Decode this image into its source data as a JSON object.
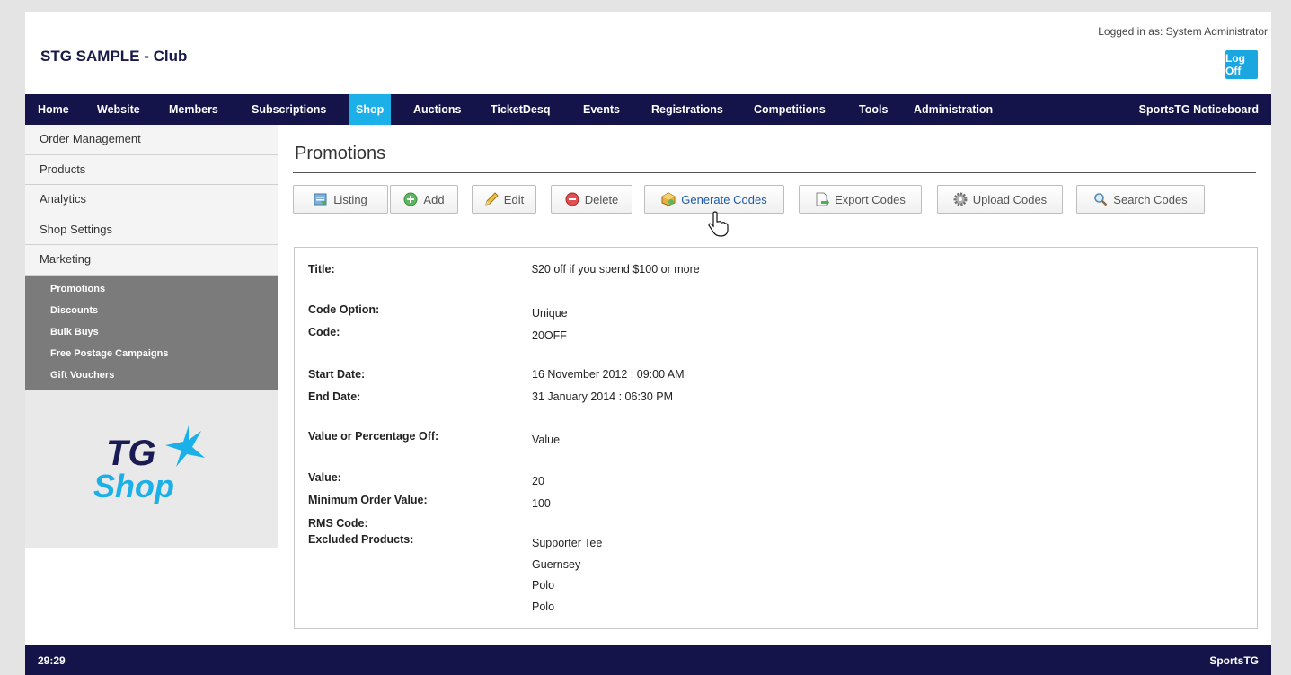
{
  "header": {
    "club_title": "STG SAMPLE - Club",
    "logged_in": "Logged in as: System Administrator",
    "logoff_label": "Log Off"
  },
  "nav": {
    "items": [
      "Home",
      "Website",
      "Members",
      "Subscriptions",
      "Shop",
      "Auctions",
      "TicketDesq",
      "Events",
      "Registrations",
      "Competitions",
      "Tools",
      "Administration"
    ],
    "active": "Shop",
    "right_item": "SportsTG Noticeboard"
  },
  "sidebar": {
    "items": [
      "Order Management",
      "Products",
      "Analytics",
      "Shop Settings",
      "Marketing"
    ],
    "submenu": [
      "Promotions",
      "Discounts",
      "Bulk Buys",
      "Free Postage Campaigns",
      "Gift Vouchers"
    ],
    "logo_line1": "TG",
    "logo_line2": "Shop"
  },
  "main": {
    "page_title": "Promotions",
    "toolbar": [
      {
        "label": "Listing",
        "icon": "listing-icon"
      },
      {
        "label": "Add",
        "icon": "add-icon"
      },
      {
        "label": "Edit",
        "icon": "edit-pencil-icon"
      },
      {
        "label": "Delete",
        "icon": "delete-icon"
      },
      {
        "label": "Generate Codes",
        "icon": "generate-codes-icon"
      },
      {
        "label": "Export Codes",
        "icon": "export-codes-icon"
      },
      {
        "label": "Upload Codes",
        "icon": "upload-codes-gear-icon"
      },
      {
        "label": "Search Codes",
        "icon": "search-icon"
      }
    ],
    "details": {
      "title_label": "Title:",
      "title_value": "$20 off if you spend $100 or more",
      "code_option_label": "Code Option:",
      "code_option_value": "Unique",
      "code_label": "Code:",
      "code_value": "20OFF",
      "start_label": "Start Date:",
      "start_value": "16 November 2012 : 09:00 AM",
      "end_label": "End Date:",
      "end_value": "31 January 2014 : 06:30 PM",
      "vpo_label": "Value or Percentage Off:",
      "vpo_value": "Value",
      "value_label": "Value:",
      "value_value": "20",
      "min_order_label": "Minimum Order Value:",
      "min_order_value": "100",
      "rms_label": "RMS Code:",
      "excluded_label": "Excluded Products:",
      "excluded_products": [
        "Supporter Tee",
        "Guernsey",
        "Polo",
        "Polo"
      ]
    }
  },
  "footer": {
    "timer": "29:29",
    "brand": "SportsTG"
  },
  "colors": {
    "nav_bg": "#14144a",
    "accent": "#1cb0e8",
    "submenu_bg": "#7b7b7b"
  }
}
